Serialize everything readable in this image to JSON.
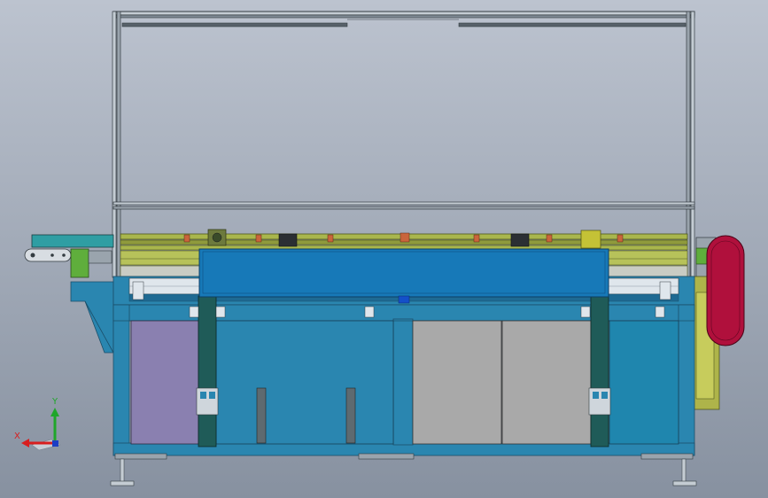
{
  "scene": {
    "background": {
      "top": "#bcc3cf",
      "bottom": "#8791a0"
    },
    "colors": {
      "frame": "#7f8a94",
      "frame_light": "#c4ccd3",
      "frame_dark": "#333b40",
      "base_blue": "#2a86b0",
      "base_blue_dark": "#1b5f82",
      "carriage_blue": "#1779b8",
      "carriage_dark": "#0c4f80",
      "teal_column": "#1f5b58",
      "purple_panel": "#8a80b0",
      "grey_panel": "#a9a9a9",
      "olive_rail": "#a9b64d",
      "olive_dark": "#6f7a2e",
      "conveyor_teal": "#2f9ea3",
      "crimson": "#b0103c",
      "yellow_green": "#aeb44a"
    }
  },
  "triad": {
    "x_label": "X",
    "y_label": "Y",
    "x_color": "#d81e1e",
    "y_color": "#1fa62a",
    "z_color": "#1d3ec4"
  }
}
